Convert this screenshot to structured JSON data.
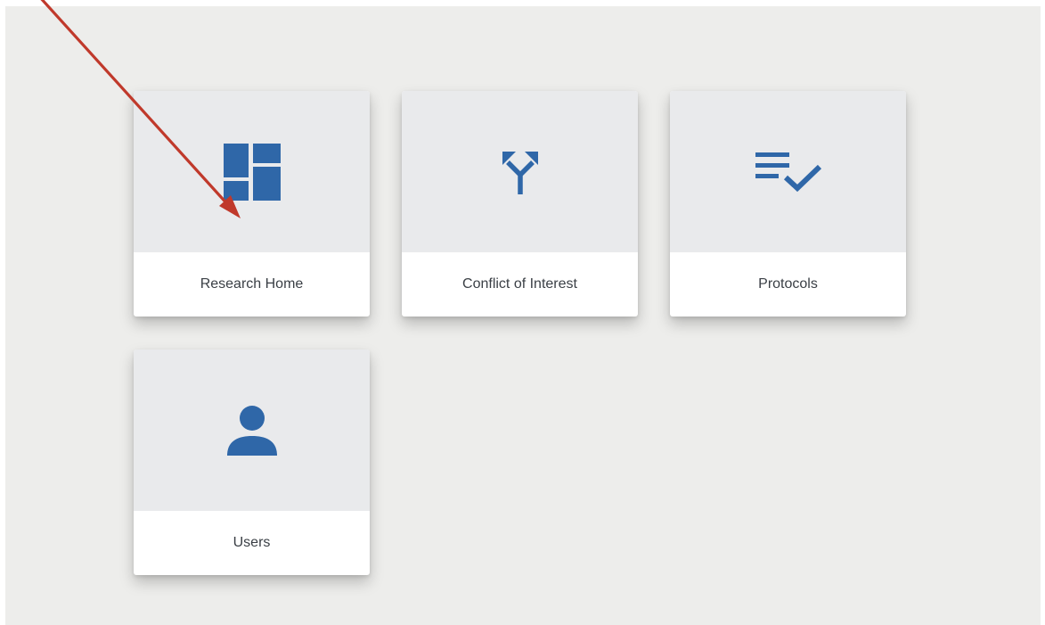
{
  "colors": {
    "icon": "#2f67a8",
    "tile_top": "#e9eaec",
    "background": "#ededeb",
    "annotation_arrow": "#c0392b"
  },
  "tiles": [
    {
      "label": "Research Home",
      "icon": "dashboard-icon"
    },
    {
      "label": "Conflict of Interest",
      "icon": "split-arrows-icon"
    },
    {
      "label": "Protocols",
      "icon": "list-check-icon"
    },
    {
      "label": "Users",
      "icon": "user-icon"
    }
  ]
}
